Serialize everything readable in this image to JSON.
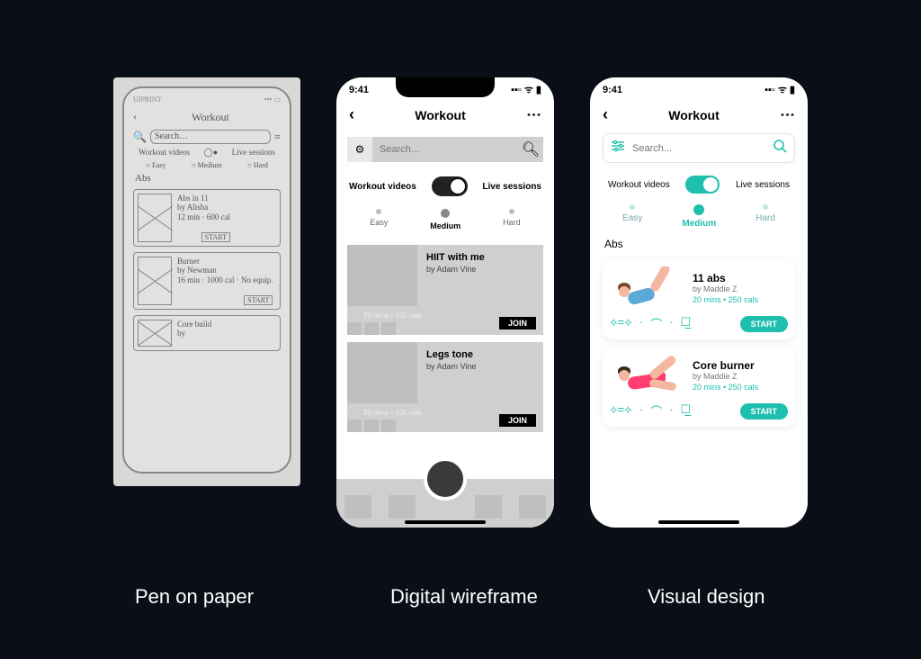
{
  "captions": {
    "paper": "Pen on paper",
    "wireframe": "Digital wireframe",
    "visual": "Visual design"
  },
  "status_time": "9:41",
  "header": {
    "title": "Workout"
  },
  "search": {
    "placeholder": "Search..."
  },
  "mode": {
    "left": "Workout videos",
    "right": "Live sessions"
  },
  "difficulty": {
    "easy": "Easy",
    "medium": "Medium",
    "hard": "Hard",
    "selected": "Medium"
  },
  "section": "Abs",
  "wireframe_cards": [
    {
      "title": "HIIT with me",
      "author": "by Adam Vine",
      "meta": "20 mins  •  100 cals",
      "cta": "JOIN"
    },
    {
      "title": "Legs tone",
      "author": "by Adam Vine",
      "meta": "20 mins  •  100 cals",
      "cta": "JOIN"
    }
  ],
  "visual_cards": [
    {
      "title": "11 abs",
      "author": "by Maddie Z",
      "meta": "20 mins • 250 cals",
      "cta": "START"
    },
    {
      "title": "Core burner",
      "author": "by Maddie Z",
      "meta": "20 mins • 250 cals",
      "cta": "START"
    }
  ],
  "paper": {
    "brand": "UIPRINT",
    "title": "Workout",
    "search": "Search…",
    "cards": [
      {
        "title": "Abs in 11",
        "by": "by Alisha",
        "meta": "12 min · 600 cal",
        "cta": "START"
      },
      {
        "title": "Burner",
        "by": "by Newman",
        "meta": "16 min · 1000 cal · No equip.",
        "cta": "START"
      },
      {
        "title": "Core build",
        "by": "by",
        "meta": "",
        "cta": ""
      }
    ]
  },
  "colors": {
    "accent": "#1fbfae",
    "dark": "#0a0e17"
  }
}
